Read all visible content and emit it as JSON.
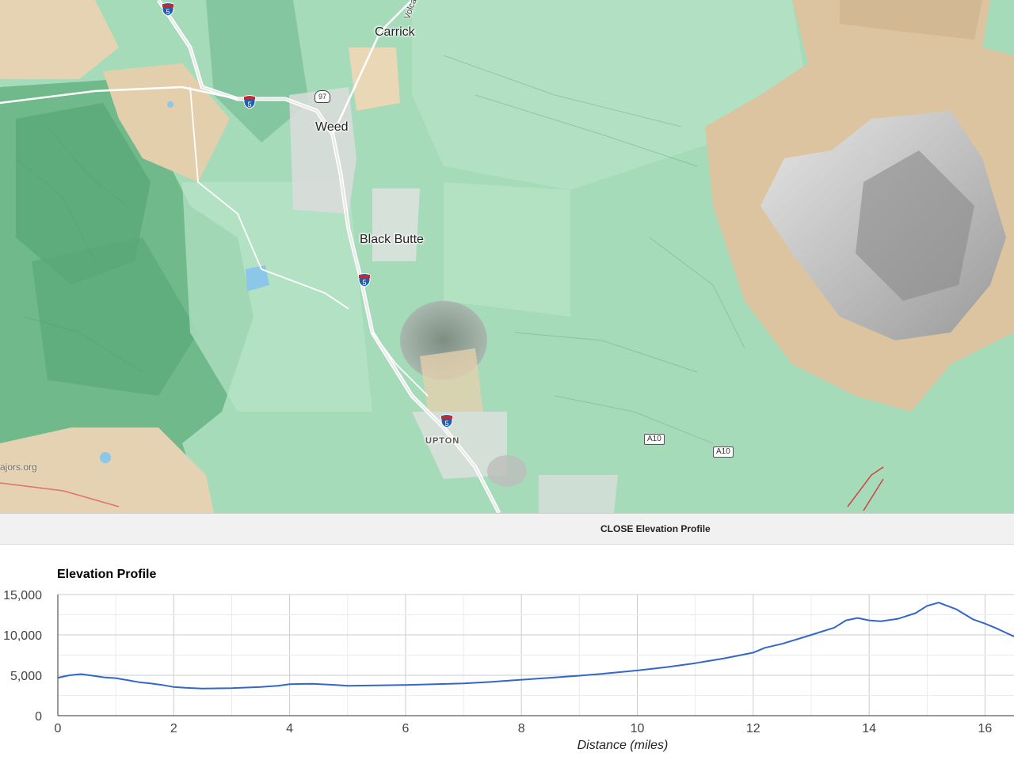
{
  "map": {
    "places": {
      "carrick": "Carrick",
      "weed": "Weed",
      "black_butte": "Black Butte",
      "upton": "UPTON",
      "volcanic_road": "Volca"
    },
    "shields": {
      "i5": "5",
      "us97": "97",
      "a10": "A10"
    },
    "attribution": "ajors.org"
  },
  "bar": {
    "close_label": "CLOSE Elevation Profile"
  },
  "chart_data": {
    "type": "line",
    "title": "Elevation Profile",
    "xlabel": "Distance (miles)",
    "ylabel": "",
    "xlim": [
      0,
      16.5
    ],
    "ylim": [
      0,
      15000
    ],
    "x_ticks": [
      "0",
      "2",
      "4",
      "6",
      "8",
      "10",
      "12",
      "14",
      "16"
    ],
    "y_ticks": [
      "0",
      "5,000",
      "10,000",
      "15,000"
    ],
    "grid": true,
    "color": "#3366cc",
    "series": [
      {
        "x": [
          0,
          0.2,
          0.4,
          0.6,
          0.8,
          1,
          1.2,
          1.4,
          1.6,
          1.8,
          2,
          2.2,
          2.5,
          3,
          3.5,
          3.8,
          4,
          4.4,
          4.8,
          5,
          5.5,
          6,
          6.5,
          7,
          7.5,
          8,
          8.5,
          9,
          9.5,
          10,
          10.5,
          11,
          11.5,
          12,
          12.2,
          12.5,
          13,
          13.4,
          13.6,
          13.8,
          14,
          14.2,
          14.5,
          14.8,
          15,
          15.2,
          15.5,
          15.8,
          16,
          16.2,
          16.5
        ],
        "y": [
          4700,
          5000,
          5150,
          4950,
          4750,
          4650,
          4400,
          4150,
          4000,
          3800,
          3550,
          3450,
          3350,
          3400,
          3550,
          3700,
          3900,
          3950,
          3800,
          3700,
          3750,
          3800,
          3900,
          4000,
          4200,
          4450,
          4700,
          4950,
          5250,
          5600,
          6000,
          6500,
          7100,
          7800,
          8400,
          8900,
          10000,
          10900,
          11800,
          12100,
          11800,
          11700,
          12000,
          12700,
          13600,
          14000,
          13200,
          11900,
          11400,
          10800,
          9800
        ]
      }
    ]
  }
}
